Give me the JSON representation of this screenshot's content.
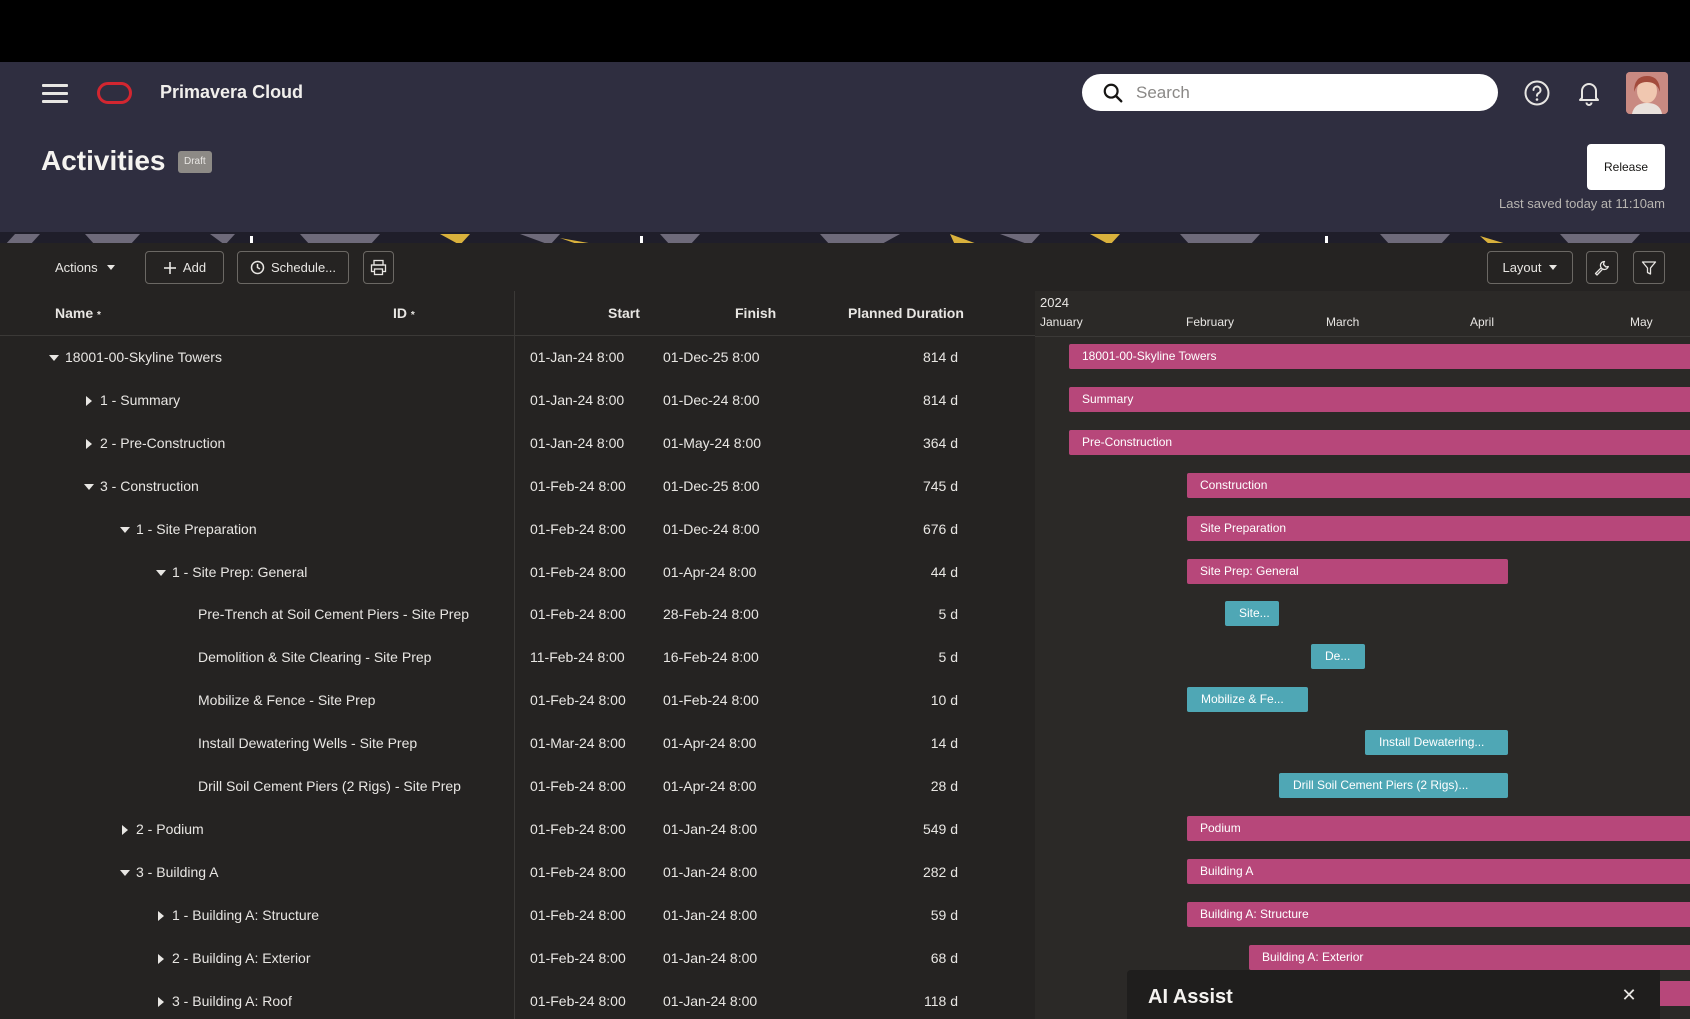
{
  "app": {
    "title": "Primavera Cloud"
  },
  "search": {
    "placeholder": "Search"
  },
  "page": {
    "title": "Activities",
    "badge": "Draft",
    "release_label": "Release",
    "last_saved": "Last saved today at 11:10am"
  },
  "toolbar": {
    "actions": "Actions",
    "add": "Add",
    "schedule": "Schedule...",
    "layout": "Layout"
  },
  "columns": {
    "name": "Name",
    "id": "ID",
    "start": "Start",
    "finish": "Finish",
    "duration": "Planned Duration"
  },
  "rows": [
    {
      "name": "18001-00-Skyline Towers",
      "start": "01-Jan-24 8:00",
      "finish": "01-Dec-25 8:00",
      "duration": "814 d",
      "bar": "18001-00-Skyline Towers"
    },
    {
      "name": "1 - Summary",
      "start": "01-Jan-24 8:00",
      "finish": "01-Dec-24 8:00",
      "duration": "814 d",
      "bar": "Summary"
    },
    {
      "name": "2 - Pre-Construction",
      "start": "01-Jan-24 8:00",
      "finish": "01-May-24 8:00",
      "duration": "364 d",
      "bar": "Pre-Construction"
    },
    {
      "name": "3 - Construction",
      "start": "01-Feb-24 8:00",
      "finish": "01-Dec-25 8:00",
      "duration": "745 d",
      "bar": "Construction"
    },
    {
      "name": "1 - Site Preparation",
      "start": "01-Feb-24 8:00",
      "finish": "01-Dec-24 8:00",
      "duration": "676 d",
      "bar": "Site Preparation"
    },
    {
      "name": "1 - Site Prep: General",
      "start": "01-Feb-24 8:00",
      "finish": "01-Apr-24 8:00",
      "duration": "44 d",
      "bar": "Site Prep: General"
    },
    {
      "name": "Pre-Trench at Soil Cement Piers - Site Prep",
      "start": "01-Feb-24 8:00",
      "finish": "28-Feb-24 8:00",
      "duration": "5 d",
      "bar": "Site..."
    },
    {
      "name": "Demolition & Site Clearing - Site Prep",
      "start": "11-Feb-24 8:00",
      "finish": "16-Feb-24 8:00",
      "duration": "5 d",
      "bar": "De..."
    },
    {
      "name": "Mobilize & Fence - Site Prep",
      "start": "01-Feb-24 8:00",
      "finish": "01-Feb-24 8:00",
      "duration": "10 d",
      "bar": "Mobilize & Fe..."
    },
    {
      "name": "Install Dewatering Wells - Site Prep",
      "start": "01-Mar-24 8:00",
      "finish": "01-Apr-24 8:00",
      "duration": "14 d",
      "bar": "Install Dewatering..."
    },
    {
      "name": "Drill Soil Cement Piers (2 Rigs) - Site Prep",
      "start": "01-Feb-24 8:00",
      "finish": "01-Apr-24 8:00",
      "duration": "28 d",
      "bar": "Drill Soil Cement Piers (2 Rigs)..."
    },
    {
      "name": "2 - Podium",
      "start": "01-Feb-24 8:00",
      "finish": "01-Jan-24 8:00",
      "duration": "549 d",
      "bar": "Podium"
    },
    {
      "name": "3 - Building A",
      "start": "01-Feb-24 8:00",
      "finish": "01-Jan-24 8:00",
      "duration": "282 d",
      "bar": "Building A"
    },
    {
      "name": "1 - Building A: Structure",
      "start": "01-Feb-24 8:00",
      "finish": "01-Jan-24 8:00",
      "duration": "59 d",
      "bar": "Building A: Structure"
    },
    {
      "name": "2 - Building A: Exterior",
      "start": "01-Feb-24 8:00",
      "finish": "01-Jan-24 8:00",
      "duration": "68 d",
      "bar": "Building A: Exterior"
    },
    {
      "name": "3 - Building A: Roof",
      "start": "01-Feb-24 8:00",
      "finish": "01-Jan-24 8:00",
      "duration": "118 d",
      "bar": ""
    }
  ],
  "gantt": {
    "year": "2024",
    "months": [
      "January",
      "February",
      "March",
      "April",
      "May"
    ]
  },
  "ai": {
    "title": "AI Assist"
  },
  "colors": {
    "accent_bar": "#b7477a",
    "task_bar": "#4fa7b5",
    "header_bg": "#2f2e40",
    "logo": "#d22630"
  }
}
